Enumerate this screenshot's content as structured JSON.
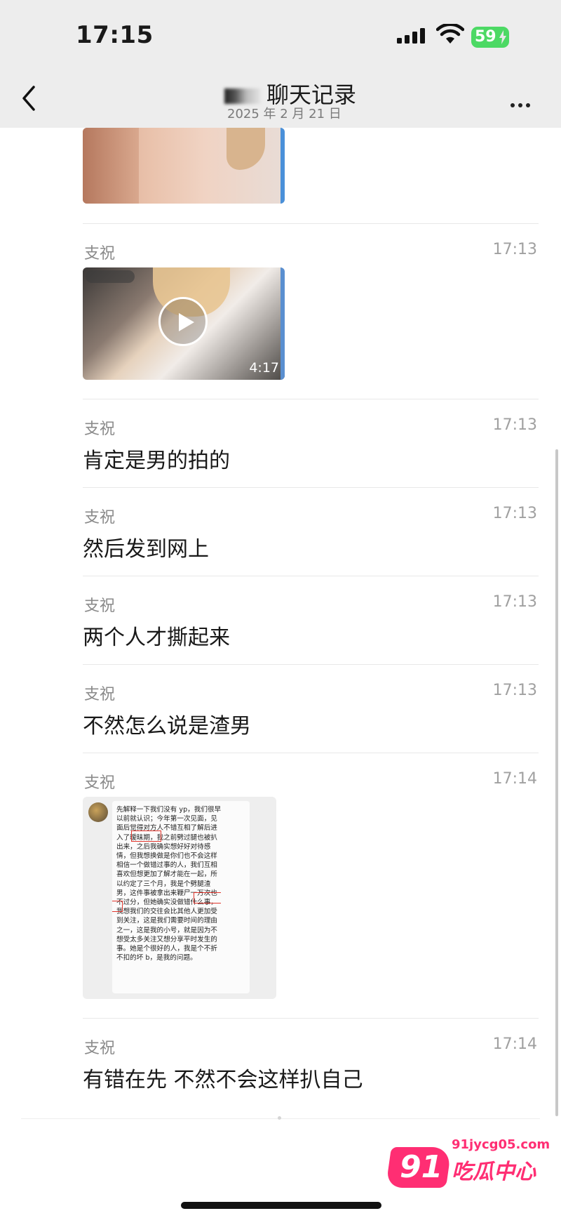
{
  "status_bar": {
    "time": "17:15",
    "battery": "59"
  },
  "header": {
    "title": "聊天记录",
    "date": "2025 年 2 月 21 日"
  },
  "messages": [
    {
      "type": "image"
    },
    {
      "sender": "支祝",
      "time": "17:13",
      "type": "video",
      "duration": "4:17"
    },
    {
      "sender": "支祝",
      "time": "17:13",
      "text": "肯定是男的拍的"
    },
    {
      "sender": "支祝",
      "time": "17:13",
      "text": "然后发到网上"
    },
    {
      "sender": "支祝",
      "time": "17:13",
      "text": "两个人才撕起来"
    },
    {
      "sender": "支祝",
      "time": "17:13",
      "text": "不然怎么说是渣男"
    },
    {
      "sender": "支祝",
      "time": "17:14",
      "type": "screenshot",
      "screenshot_lines": [
        "先解释一下我们没有 yp，我们很早",
        "以前就认识；今年第一次见面，见",
        "面后觉得对方人不错互相了解后进",
        "入了暧昧期，我之前劈过腿也被扒",
        "出来，之后我确实想好好对待感",
        "情，但我想换做是你们也不会这样",
        "相信一个做错过事的人，我们互相",
        "喜欢但想更加了解才能在一起，所",
        "以约定了三个月，我是个劈腿渣",
        "男，这件事被拿出来鞭尸一万次也",
        "不过分，但她确实没做错什么事，",
        "我想我们的交往会比其他人更加受",
        "到关注，这是我们需要时间的理由",
        "之一，这是我的小号，就是因为不",
        "想受太多关注又想分享平时发生的",
        "事。她是个很好的人，我是个不折",
        "不扣的坏 b，是我的问题。"
      ]
    },
    {
      "sender": "支祝",
      "time": "17:14",
      "text": "有错在先 不然不会这样扒自己"
    }
  ],
  "watermark": {
    "number": "91",
    "url": "91jycg05.com",
    "name": "吃瓜中心"
  }
}
